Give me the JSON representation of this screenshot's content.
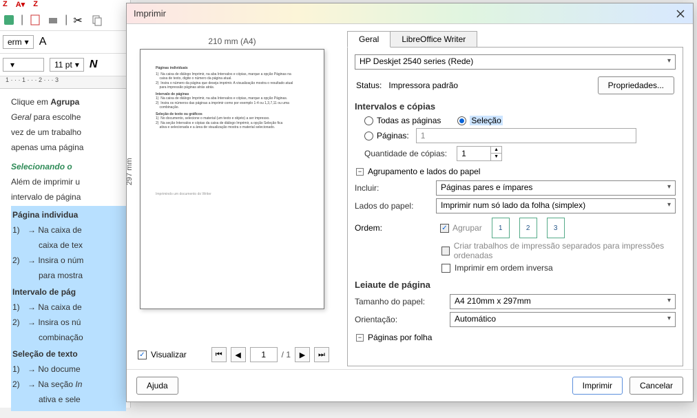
{
  "bg": {
    "para_label": "erm",
    "font_size": "11 pt",
    "ruler": "1 · · · 1 · · · 2 · · · 3",
    "doc": {
      "l1_pre": "Clique em ",
      "l1_bold": "Agrupa",
      "l2_it": "Geral",
      "l2_rest": " para escolhe",
      "l3": "vez de um trabalho",
      "l4": "apenas uma página",
      "h1": "Selecionando o ",
      "p1": "Além de imprimir u",
      "p2": "intervalo de página",
      "b1": "Página individua",
      "i1a": "Na caixa de",
      "i1b": "caixa de tex",
      "i2a": "Insira o núm",
      "i2b": "para mostra",
      "b2": "Intervalo de pág",
      "i3": "Na caixa de",
      "i4a": "Insira os nú",
      "i4b": "combinação",
      "b3": "Seleção de texto",
      "i5": "No docume",
      "i6a": "Na seção ",
      "i6a_it": "In",
      "i6b": "ativa e sele"
    }
  },
  "dialog": {
    "title": "Imprimir",
    "tabs": {
      "general": "Geral",
      "writer": "LibreOffice Writer"
    },
    "printer": {
      "selected": "HP Deskjet 2540 series (Rede)",
      "status_label": "Status:",
      "status_value": "Impressora padrão",
      "properties": "Propriedades..."
    },
    "ranges": {
      "section": "Intervalos e cópias",
      "all": "Todas as páginas",
      "selection": "Seleção",
      "pages": "Páginas:",
      "pages_value": "1",
      "copies_label": "Quantidade de cópias:",
      "copies_value": "1",
      "collate_section": "Agrupamento e lados do papel",
      "include_label": "Incluir:",
      "include_value": "Páginas pares e ímpares",
      "sides_label": "Lados do papel:",
      "sides_value": "Imprimir num só lado da folha (simplex)",
      "order_label": "Ordem:",
      "collate_chk": "Agrupar",
      "stack1": "1",
      "stack2": "2",
      "stack3": "3",
      "separate_jobs": "Criar trabalhos de impressão separados para impressões ordenadas",
      "reverse": "Imprimir em ordem inversa"
    },
    "layout": {
      "section": "Leiaute de página",
      "size_label": "Tamanho do papel:",
      "size_value": "A4 210mm x 297mm",
      "orient_label": "Orientação:",
      "orient_value": "Automático",
      "per_sheet": "Páginas por folha"
    },
    "preview": {
      "width": "210 mm (A4)",
      "height": "297 mm",
      "visualize": "Visualizar",
      "page_current": "1",
      "page_total": "/ 1"
    },
    "footer": {
      "help": "Ajuda",
      "print": "Imprimir",
      "cancel": "Cancelar"
    }
  }
}
